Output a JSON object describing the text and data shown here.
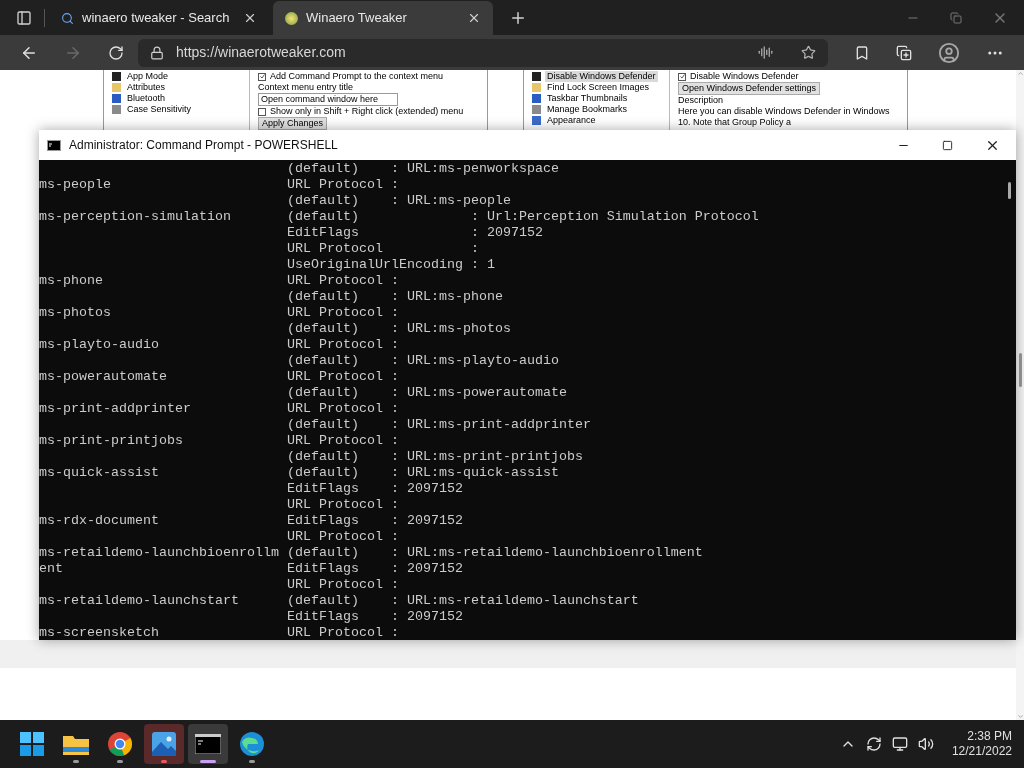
{
  "browser": {
    "tabs": [
      {
        "title": "winaero tweaker - Search",
        "kind": "search",
        "selected": false
      },
      {
        "title": "Winaero Tweaker",
        "kind": "site",
        "selected": true
      }
    ],
    "address": "https://winaerotweaker.com",
    "forward_disabled": true
  },
  "page": {
    "shots": [
      {
        "tree": [
          {
            "label": "App Mode",
            "selected": false
          },
          {
            "label": "Attributes",
            "selected": false
          },
          {
            "label": "Bluetooth",
            "selected": false
          },
          {
            "label": "Case Sensitivity",
            "selected": false
          }
        ],
        "options": [
          {
            "kind": "checkbox",
            "label": "Add Command Prompt to the context menu",
            "checked": true
          },
          {
            "kind": "label",
            "label": "Context menu entry title"
          },
          {
            "kind": "field",
            "value": "Open command window here"
          },
          {
            "kind": "checkbox",
            "label": "Show only in Shift + Right click (extended) menu",
            "checked": false
          },
          {
            "kind": "button",
            "label": "Apply Changes"
          }
        ]
      },
      {
        "tree": [
          {
            "label": "Disable Windows Defender",
            "selected": true
          },
          {
            "label": "Find Lock Screen Images",
            "selected": false
          },
          {
            "label": "Taskbar Thumbnails",
            "selected": false
          },
          {
            "label": "Manage Bookmarks",
            "selected": false
          },
          {
            "label": "Appearance",
            "selected": false
          }
        ],
        "options": [
          {
            "kind": "checkbox",
            "label": "Disable Windows Defender",
            "checked": true
          },
          {
            "kind": "button",
            "label": "Open Windows Defender settings"
          },
          {
            "kind": "label",
            "label": "Description"
          },
          {
            "kind": "text",
            "label": "Here you can disable Windows Defender in Windows 10. Note that Group Policy a"
          }
        ]
      }
    ]
  },
  "console": {
    "title": "Administrator: Command Prompt - POWERSHELL",
    "lines": [
      "                               (default)    : URL:ms-penworkspace",
      "ms-people                      URL Protocol :",
      "                               (default)    : URL:ms-people",
      "ms-perception-simulation       (default)              : Url:Perception Simulation Protocol",
      "                               EditFlags              : 2097152",
      "                               URL Protocol           :",
      "                               UseOriginalUrlEncoding : 1",
      "ms-phone                       URL Protocol :",
      "                               (default)    : URL:ms-phone",
      "ms-photos                      URL Protocol :",
      "                               (default)    : URL:ms-photos",
      "ms-playto-audio                URL Protocol :",
      "                               (default)    : URL:ms-playto-audio",
      "ms-powerautomate               URL Protocol :",
      "                               (default)    : URL:ms-powerautomate",
      "ms-print-addprinter            URL Protocol :",
      "                               (default)    : URL:ms-print-addprinter",
      "ms-print-printjobs             URL Protocol :",
      "                               (default)    : URL:ms-print-printjobs",
      "ms-quick-assist                (default)    : URL:ms-quick-assist",
      "                               EditFlags    : 2097152",
      "                               URL Protocol :",
      "ms-rdx-document                EditFlags    : 2097152",
      "                               URL Protocol :",
      "ms-retaildemo-launchbioenrollm (default)    : URL:ms-retaildemo-launchbioenrollment",
      "ent                            EditFlags    : 2097152",
      "                               URL Protocol :",
      "ms-retaildemo-launchstart      (default)    : URL:ms-retaildemo-launchstart",
      "                               EditFlags    : 2097152",
      "ms-screensketch                URL Protocol :"
    ]
  },
  "taskbar": {
    "apps": [
      {
        "kind": "start",
        "running": false,
        "selected": false,
        "attention": false
      },
      {
        "kind": "folder",
        "running": true,
        "selected": false,
        "attention": false
      },
      {
        "kind": "chrome",
        "running": true,
        "selected": false,
        "attention": false
      },
      {
        "kind": "photos",
        "running": true,
        "selected": false,
        "attention": true
      },
      {
        "kind": "terminal",
        "running": true,
        "selected": true,
        "attention": false
      },
      {
        "kind": "edge",
        "running": true,
        "selected": false,
        "attention": false
      }
    ],
    "time": "2:38 PM",
    "date": "12/21/2022"
  }
}
